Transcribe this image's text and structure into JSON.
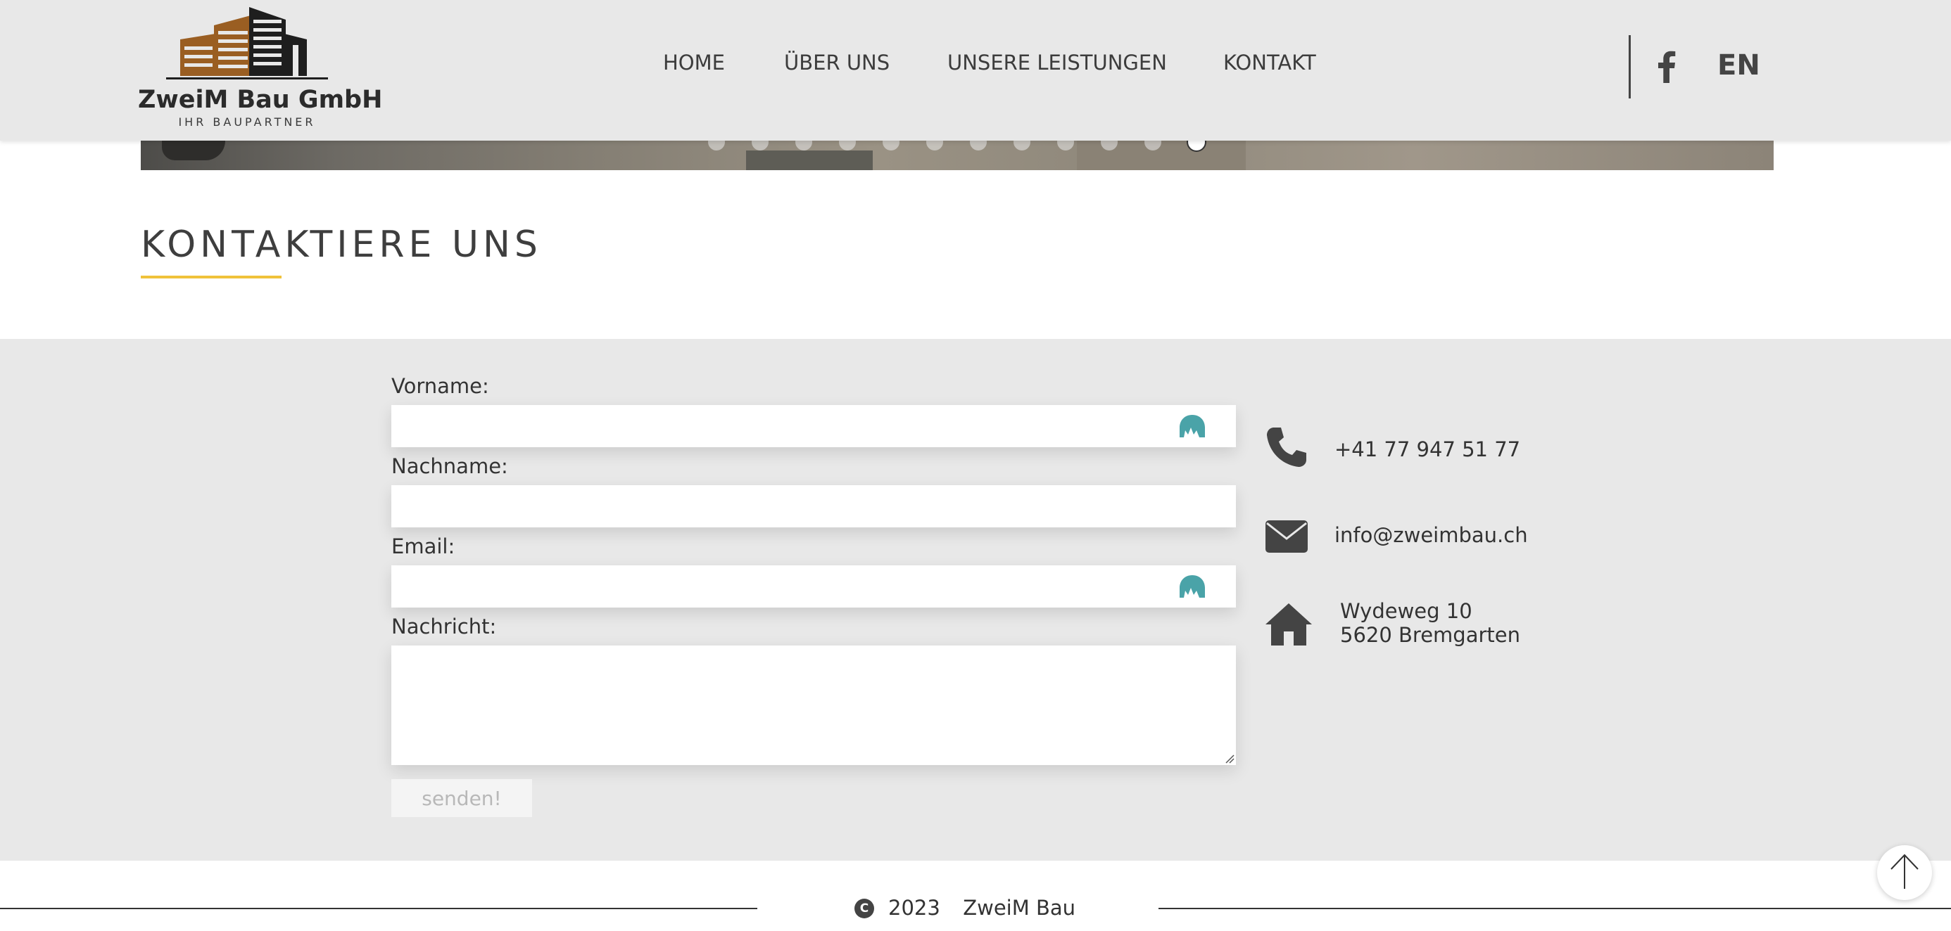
{
  "brand": {
    "name": "ZweiM Bau GmbH",
    "tagline": "IHR BAUPARTNER",
    "logo_colors": {
      "accent": "#9a5e22",
      "dark": "#1e1e1e"
    }
  },
  "nav": {
    "items": [
      {
        "label": "HOME"
      },
      {
        "label": "ÜBER UNS"
      },
      {
        "label": "UNSERE LEISTUNGEN"
      },
      {
        "label": "KONTAKT"
      }
    ],
    "social_icon": "facebook-icon",
    "language": "EN"
  },
  "slider": {
    "dot_count": 12,
    "active_index": 11
  },
  "page": {
    "title": "KONTAKTIERE UNS",
    "title_underline_color": "#f0c23a"
  },
  "form": {
    "first_name_label": "Vorname:",
    "last_name_label": "Nachname:",
    "email_label": "Email:",
    "message_label": "Nachricht:",
    "first_name_value": "",
    "last_name_value": "",
    "email_value": "",
    "message_value": "",
    "submit_label": "senden!"
  },
  "contact": {
    "phone": "+41 77 947 51 77",
    "email": "info@zweimbau.ch",
    "address_line1": "Wydeweg 10",
    "address_line2": "5620 Bremgarten",
    "icons": [
      "phone-icon",
      "envelope-icon",
      "home-icon"
    ]
  },
  "footer": {
    "year": "2023",
    "company": "ZweiM Bau",
    "copyright_symbol": "C"
  },
  "colors": {
    "header_bg": "#e8e8e8",
    "form_bg": "#e8e8e8",
    "text": "#333333",
    "password_icon": "#4aa3a8"
  }
}
